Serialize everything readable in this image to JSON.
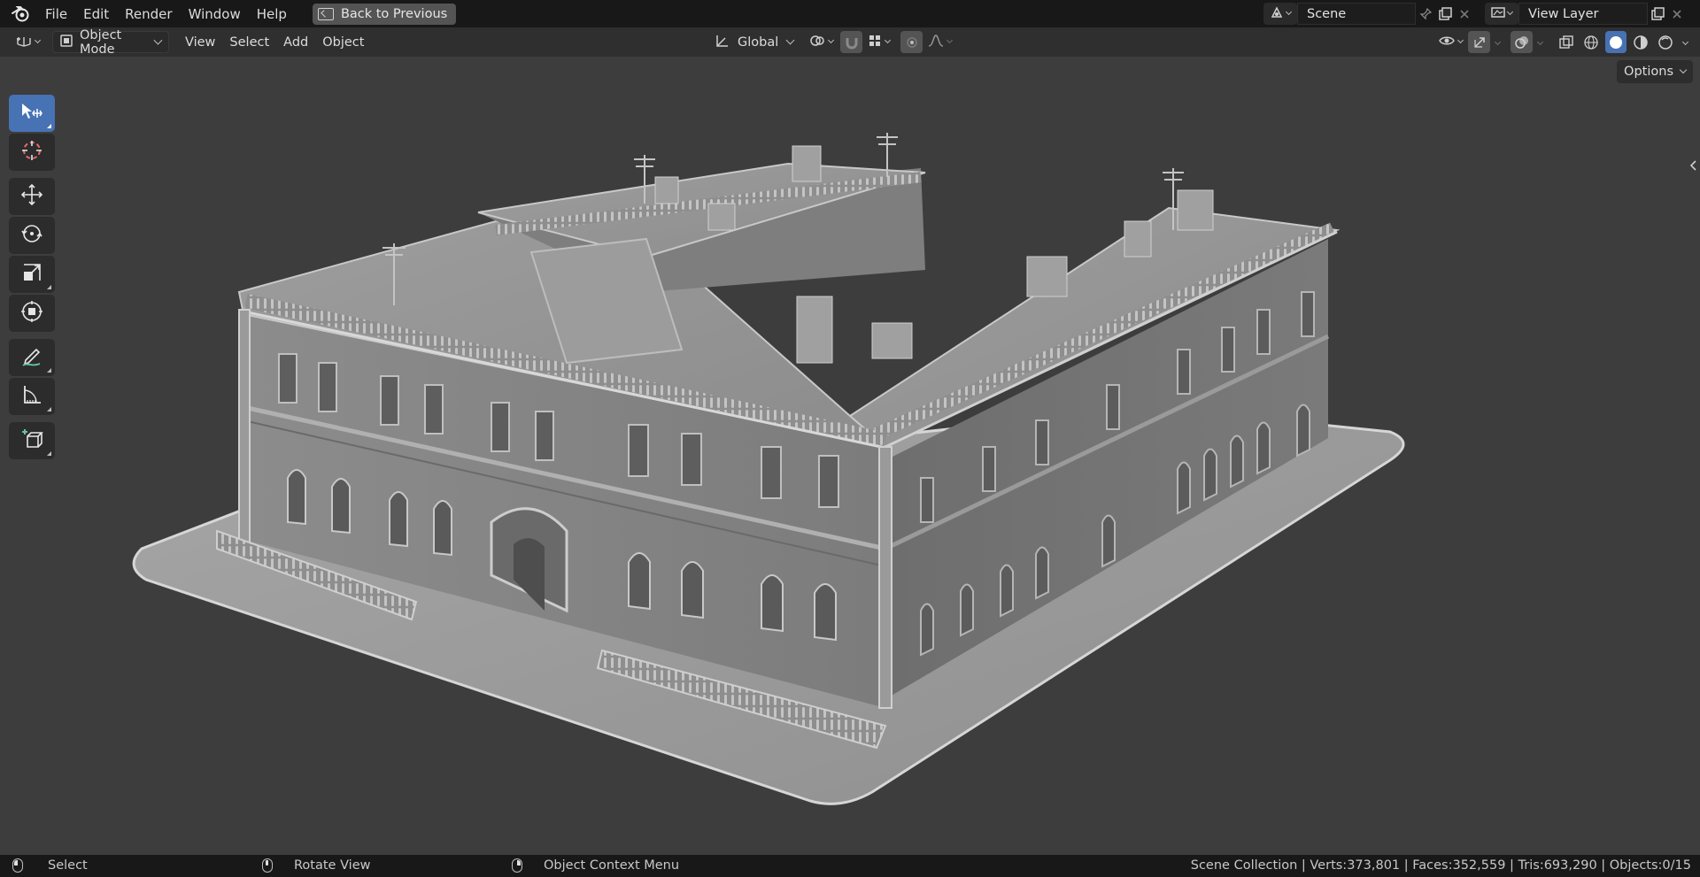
{
  "topbar": {
    "menus": [
      "File",
      "Edit",
      "Render",
      "Window",
      "Help"
    ],
    "back_button": "Back to Previous",
    "scene_name": "Scene",
    "view_layer_name": "View Layer"
  },
  "header": {
    "mode": "Object Mode",
    "menus": [
      "View",
      "Select",
      "Add",
      "Object"
    ],
    "transform_orientation": "Global",
    "options_label": "Options"
  },
  "toolbar": {
    "tools": [
      "select-box",
      "cursor",
      "move",
      "rotate",
      "scale",
      "transform",
      "annotate",
      "measure",
      "add-cube"
    ],
    "active_tool": "select-box",
    "accent": "#4772b3"
  },
  "viewport": {
    "object": "classical three-storey building model on a rounded plinth, solid shading",
    "background": "#3d3d3d"
  },
  "statusbar": {
    "left_action": "Select",
    "middle_action": "Rotate View",
    "right_action": "Object Context Menu",
    "stats": "Scene Collection | Verts:373,801 | Faces:352,559 | Tris:693,290 | Objects:0/15"
  }
}
